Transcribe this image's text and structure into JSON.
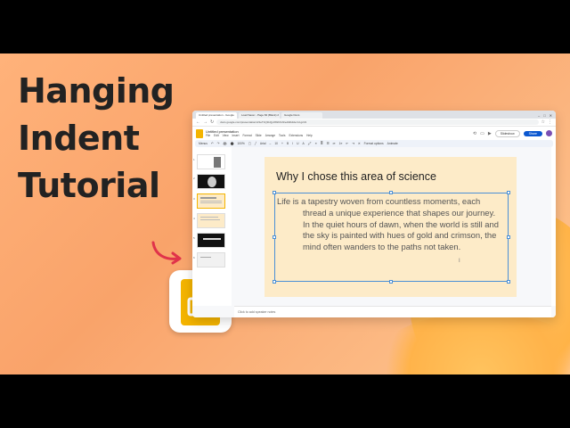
{
  "headline": {
    "line1": "Hanging",
    "line2": "Indent",
    "line3": "Tutorial"
  },
  "browser": {
    "tabs": [
      "Untitled presentation - Google",
      "Load Saver - Page 84 (Blank) 2",
      "Google Docs"
    ],
    "window_controls": [
      "–",
      "□",
      "✕"
    ],
    "url": "docs.google.com/presentation/d/1eT1Q9xQp3tWbKc9/edit#slide=id.g2c9"
  },
  "doc": {
    "title": "Untitled presentation",
    "menu": [
      "File",
      "Edit",
      "View",
      "Insert",
      "Format",
      "Slide",
      "Arrange",
      "Tools",
      "Extensions",
      "Help"
    ],
    "slideshow_label": "Slideshow",
    "share_label": "Share"
  },
  "toolbar": {
    "items": [
      "Menus",
      "↶",
      "↷",
      "🖨",
      "⬤",
      "100%",
      "▢",
      "╱",
      "Arial",
      "–",
      "10",
      "+",
      "B",
      "I",
      "U",
      "A",
      "🖍",
      "≡",
      "≣",
      "☰",
      "•≡",
      "1≡",
      "⇤",
      "⇥",
      "✕",
      "Format options",
      "Animate"
    ]
  },
  "filmstrip": {
    "slide_numbers": [
      "1",
      "2",
      "3",
      "4",
      "5",
      "6"
    ]
  },
  "slide": {
    "title": "Why I chose this area of science",
    "paragraph": "Life is a tapestry woven from countless moments, each thread a unique experience that shapes our journey. In the quiet hours of dawn, when the world is still and the sky is painted with hues of gold and crimson, the mind often wanders to the paths not taken."
  },
  "notes": {
    "placeholder": "Click to add speaker notes"
  },
  "colors": {
    "banner": "#f9a36a",
    "slide_bg": "#fdebc8",
    "selection": "#4a8fd6",
    "share": "#0b57d0",
    "slides_yellow": "#f4b400",
    "arrow": "#e0334a"
  }
}
